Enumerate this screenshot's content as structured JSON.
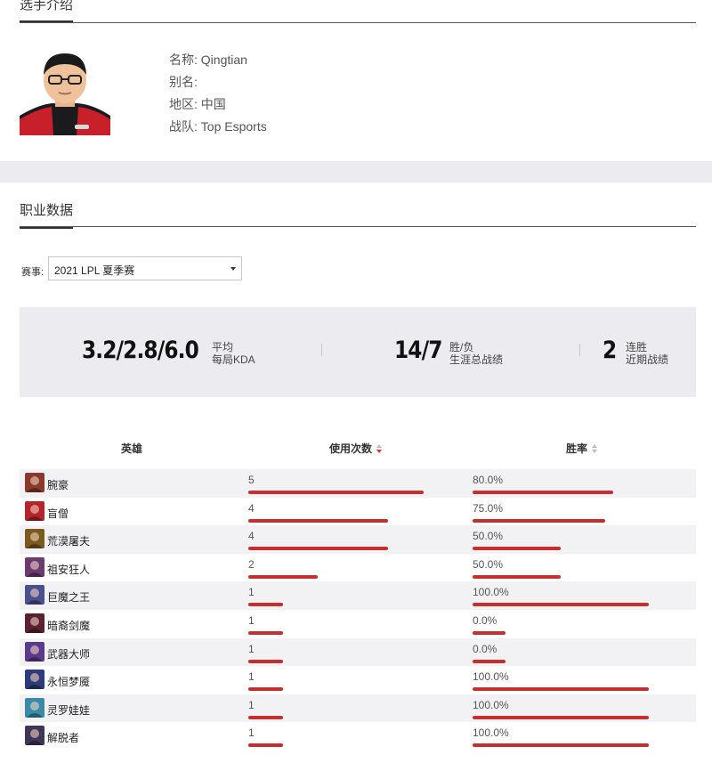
{
  "intro": {
    "section_title": "选手介绍",
    "fields": [
      {
        "label": "名称:",
        "value": "Qingtian"
      },
      {
        "label": "别名:",
        "value": ""
      },
      {
        "label": "地区:",
        "value": "中国"
      },
      {
        "label": "战队:",
        "value": "Top Esports"
      }
    ]
  },
  "career": {
    "section_title": "职业数据",
    "filter_label": "赛事:",
    "selected_event": "2021 LPL 夏季赛",
    "stats": [
      {
        "value": "3.2/2.8/6.0",
        "label_top": "平均",
        "label_bottom": "每局KDA"
      },
      {
        "value": "14/7",
        "label_top": "胜/负",
        "label_bottom": "生涯总战绩"
      },
      {
        "value": "2",
        "label_top": "连胜",
        "label_bottom": "近期战绩"
      }
    ],
    "table_headers": {
      "hero": "英雄",
      "count": "使用次数",
      "winrate": "胜率"
    },
    "bar_color": "#c62f2f",
    "heroes": [
      {
        "name": "腕豪",
        "count": 5,
        "count_label": "5",
        "winrate": 80.0,
        "winrate_label": "80.0%",
        "icon": "hero-sett-portrait",
        "color": "#8a3a2c"
      },
      {
        "name": "盲僧",
        "count": 4,
        "count_label": "4",
        "winrate": 75.0,
        "winrate_label": "75.0%",
        "icon": "hero-leesin-portrait",
        "color": "#b3242c"
      },
      {
        "name": "荒漠屠夫",
        "count": 4,
        "count_label": "4",
        "winrate": 50.0,
        "winrate_label": "50.0%",
        "icon": "hero-renekton-portrait",
        "color": "#7a5a1e"
      },
      {
        "name": "祖安狂人",
        "count": 2,
        "count_label": "2",
        "winrate": 50.0,
        "winrate_label": "50.0%",
        "icon": "hero-drmundo-portrait",
        "color": "#6b3a6e"
      },
      {
        "name": "巨魔之王",
        "count": 1,
        "count_label": "1",
        "winrate": 100.0,
        "winrate_label": "100.0%",
        "icon": "hero-trundle-portrait",
        "color": "#4a4f8e"
      },
      {
        "name": "暗裔剑魔",
        "count": 1,
        "count_label": "1",
        "winrate": 0.0,
        "winrate_label": "0.0%",
        "icon": "hero-aatrox-portrait",
        "color": "#5a2230"
      },
      {
        "name": "武器大师",
        "count": 1,
        "count_label": "1",
        "winrate": 0.0,
        "winrate_label": "0.0%",
        "icon": "hero-jax-portrait",
        "color": "#5b3a8c"
      },
      {
        "name": "永恒梦魇",
        "count": 1,
        "count_label": "1",
        "winrate": 100.0,
        "winrate_label": "100.0%",
        "icon": "hero-nocturne-portrait",
        "color": "#2e3a7a"
      },
      {
        "name": "灵罗娃娃",
        "count": 1,
        "count_label": "1",
        "winrate": 100.0,
        "winrate_label": "100.0%",
        "icon": "hero-gwen-portrait",
        "color": "#3a8aa8"
      },
      {
        "name": "解脱者",
        "count": 1,
        "count_label": "1",
        "winrate": 100.0,
        "winrate_label": "100.0%",
        "icon": "hero-sylas-portrait",
        "color": "#3e3656"
      }
    ]
  }
}
